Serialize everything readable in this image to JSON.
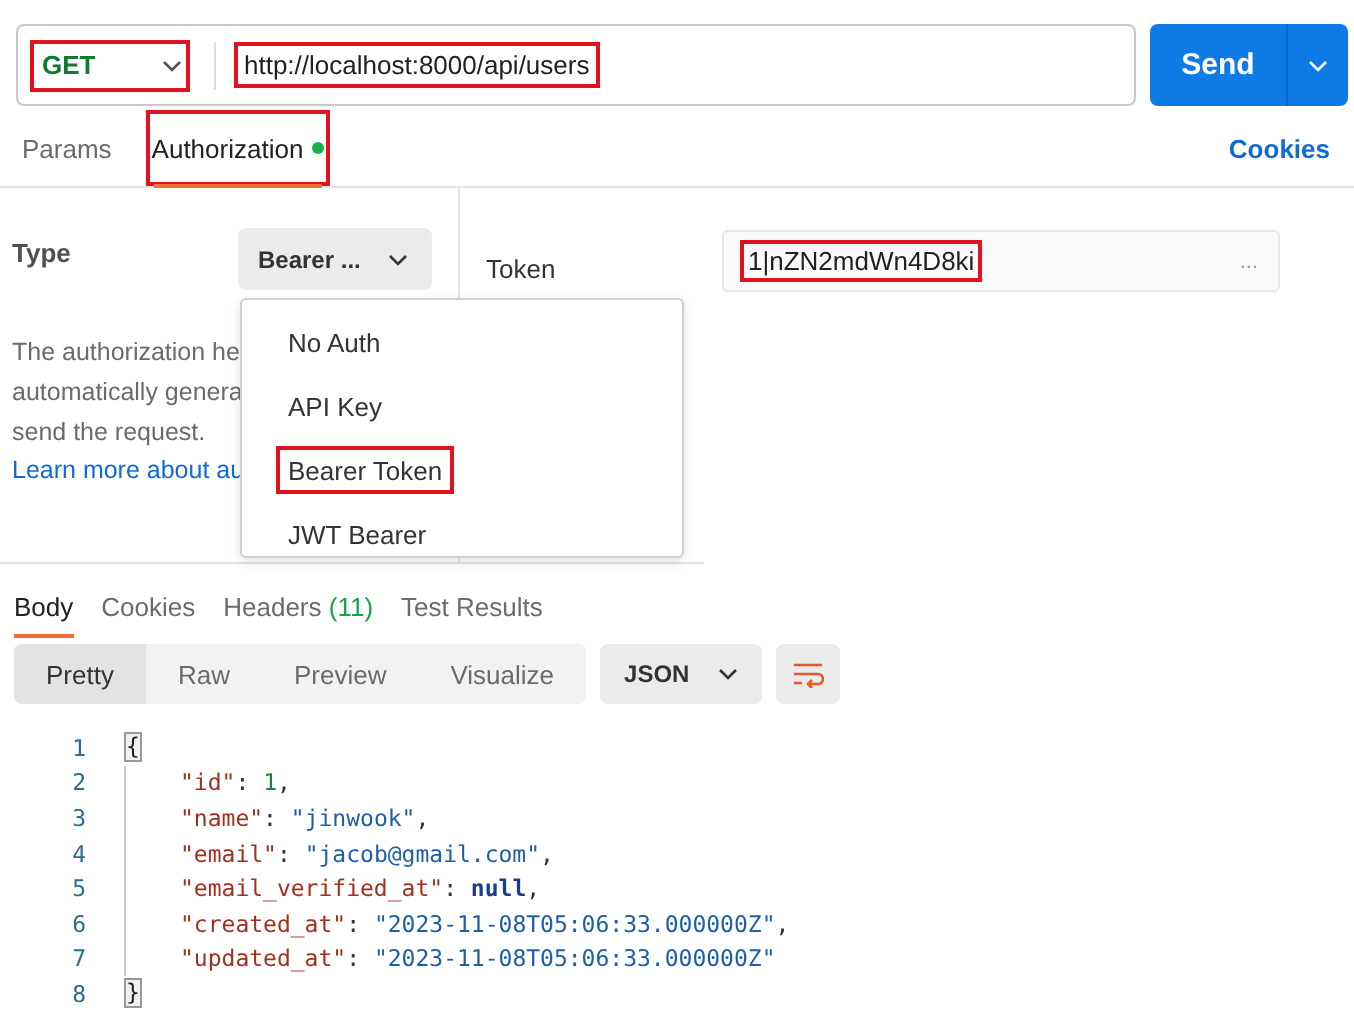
{
  "request": {
    "method": {
      "label": "GET",
      "highlighted": true
    },
    "url": {
      "value": "http://localhost:8000/api/users",
      "highlighted": true
    },
    "send": "Send"
  },
  "request_tabs": [
    {
      "label": "Params",
      "selected": false,
      "highlighted": false,
      "dot": false
    },
    {
      "label": "Authorization",
      "selected": true,
      "highlighted": true,
      "dot": true
    }
  ],
  "cookies_link": "Cookies",
  "auth": {
    "type_label": "Type",
    "type_value": "Bearer ...",
    "description_lines": [
      "The authorization he",
      "automatically genera",
      "send the request."
    ],
    "learn_more": "Learn more about au",
    "menu": [
      {
        "label": "No Auth",
        "highlighted": false
      },
      {
        "label": "API Key",
        "highlighted": false
      },
      {
        "label": "Bearer Token",
        "highlighted": true
      },
      {
        "label": "JWT Bearer",
        "highlighted": false
      }
    ],
    "token_label": "Token",
    "token": {
      "value": "1|nZN2mdWn4D8ki",
      "highlighted": true
    },
    "token_more": "..."
  },
  "response_tabs": [
    {
      "label": "Body",
      "selected": true
    },
    {
      "label": "Cookies",
      "selected": false
    },
    {
      "label": "Headers",
      "count": "(11)",
      "selected": false
    },
    {
      "label": "Test Results",
      "selected": false
    }
  ],
  "view_modes": [
    {
      "label": "Pretty",
      "selected": true
    },
    {
      "label": "Raw",
      "selected": false
    },
    {
      "label": "Preview",
      "selected": false
    },
    {
      "label": "Visualize",
      "selected": false
    }
  ],
  "format": "JSON",
  "code_lines": [
    {
      "number": "1",
      "tokens": [
        {
          "kind": "brace",
          "text": "{"
        }
      ]
    },
    {
      "number": "2",
      "tokens": [
        {
          "kind": "key",
          "text": "\"id\""
        },
        {
          "kind": "punct",
          "text": ": "
        },
        {
          "kind": "number",
          "text": "1"
        },
        {
          "kind": "punct",
          "text": ","
        }
      ]
    },
    {
      "number": "3",
      "tokens": [
        {
          "kind": "key",
          "text": "\"name\""
        },
        {
          "kind": "punct",
          "text": ": "
        },
        {
          "kind": "string",
          "text": "\"jinwook\""
        },
        {
          "kind": "punct",
          "text": ","
        }
      ]
    },
    {
      "number": "4",
      "tokens": [
        {
          "kind": "key",
          "text": "\"email\""
        },
        {
          "kind": "punct",
          "text": ": "
        },
        {
          "kind": "string",
          "text": "\"jacob@gmail.com\""
        },
        {
          "kind": "punct",
          "text": ","
        }
      ]
    },
    {
      "number": "5",
      "tokens": [
        {
          "kind": "key",
          "text": "\"email_verified_at\""
        },
        {
          "kind": "punct",
          "text": ": "
        },
        {
          "kind": "null",
          "text": "null"
        },
        {
          "kind": "punct",
          "text": ","
        }
      ]
    },
    {
      "number": "6",
      "tokens": [
        {
          "kind": "key",
          "text": "\"created_at\""
        },
        {
          "kind": "punct",
          "text": ": "
        },
        {
          "kind": "string",
          "text": "\"2023-11-08T05:06:33.000000Z\""
        },
        {
          "kind": "punct",
          "text": ","
        }
      ]
    },
    {
      "number": "7",
      "tokens": [
        {
          "kind": "key",
          "text": "\"updated_at\""
        },
        {
          "kind": "punct",
          "text": ": "
        },
        {
          "kind": "string",
          "text": "\"2023-11-08T05:06:33.000000Z\""
        }
      ]
    },
    {
      "number": "8",
      "tokens": [
        {
          "kind": "brace",
          "text": "}"
        }
      ]
    }
  ]
}
